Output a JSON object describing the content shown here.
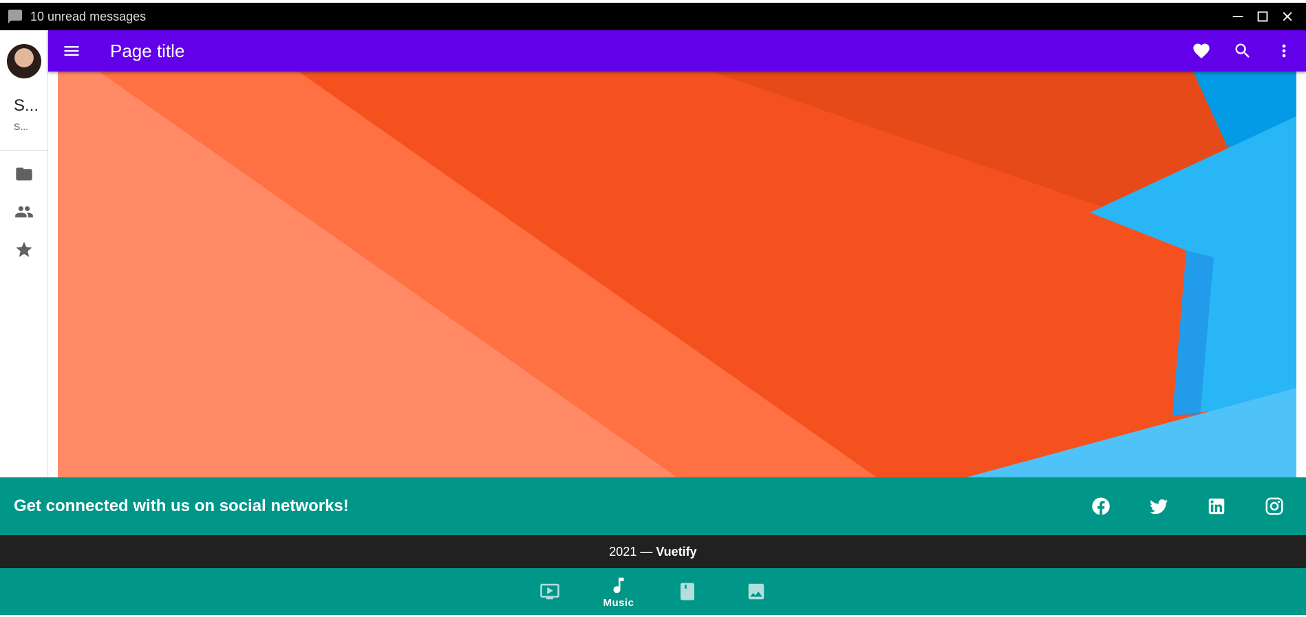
{
  "window": {
    "title": "10 unread messages",
    "icon": "chat-bubble-icon",
    "controls": [
      "minimize-icon",
      "maximize-icon",
      "close-icon"
    ]
  },
  "rail": {
    "avatar": "avatar",
    "name": "S...",
    "subtitle": "S...",
    "items": [
      {
        "icon": "folder-icon"
      },
      {
        "icon": "people-icon"
      },
      {
        "icon": "star-icon"
      }
    ]
  },
  "appbar": {
    "title": "Page title",
    "color": "#6200ea",
    "actions": [
      "heart-icon",
      "search-icon",
      "more-vert-icon"
    ]
  },
  "footer": {
    "headline": "Get connected with us on social networks!",
    "socials": [
      "facebook-icon",
      "twitter-icon",
      "linkedin-icon",
      "instagram-icon"
    ],
    "year_text": "2021 —",
    "brand": "Vuetify",
    "color": "#009688"
  },
  "bottom_nav": {
    "items": [
      {
        "icon": "video-icon",
        "label": ""
      },
      {
        "icon": "music-note-icon",
        "label": "Music",
        "active": true
      },
      {
        "icon": "book-icon",
        "label": ""
      },
      {
        "icon": "image-icon",
        "label": ""
      }
    ]
  }
}
